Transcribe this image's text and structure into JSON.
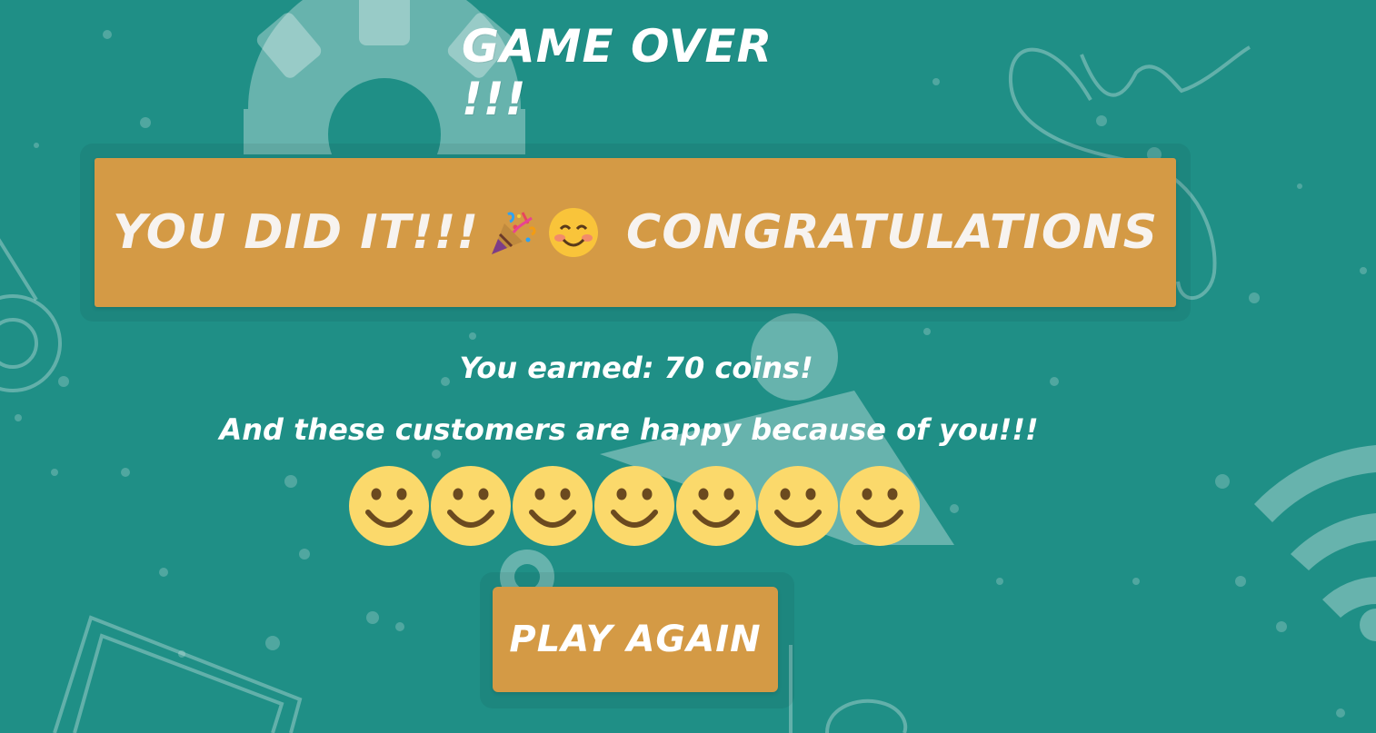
{
  "screen": {
    "title": "GAME OVER !!!",
    "banner": {
      "lead_text": "YOU DID IT!!!",
      "icon_1": "party-popper-icon",
      "icon_2": "smiling-face-icon",
      "tail_text": "CONGRATULATIONS"
    },
    "earned_text": "You earned: 70 coins!",
    "happy_text": "And these customers are happy because of you!!!",
    "happy_customers": {
      "count": 7,
      "icon": "smiley-face-icon"
    },
    "play_again_label": "PLAY AGAIN"
  },
  "colors": {
    "background": "#1f8f86",
    "accent": "#d49a45",
    "text": "#ffffff",
    "smiley": "#fbd96b"
  }
}
